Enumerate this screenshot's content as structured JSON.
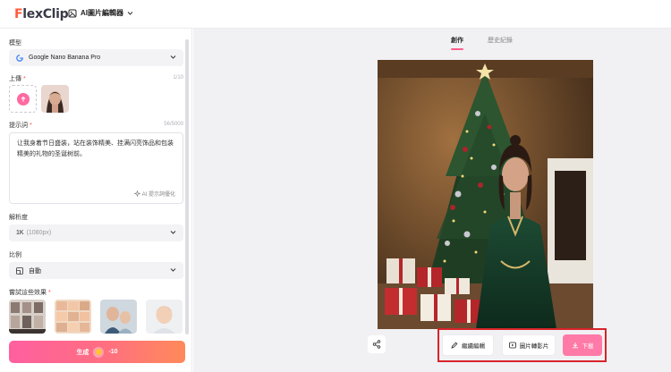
{
  "header": {
    "logo_prefix": "F",
    "logo_text": "lexClip",
    "tool_switch_label": "AI圖片編輯器"
  },
  "left_panel": {
    "model": {
      "label": "模型",
      "selected": "Google Nano Banana Pro"
    },
    "upload": {
      "label": "上傳",
      "required_mark": "*",
      "counter": "1/10"
    },
    "prompt": {
      "label": "提示詞",
      "required_mark": "*",
      "counter": "56/5000",
      "text": "让我身着节日盛装，站在装饰精美、挂满闪亮饰品和包装精美的礼物的圣诞树前。",
      "optimize_label": "AI 提示詞優化"
    },
    "resolution": {
      "label": "解析度",
      "selected": "1K",
      "selected_detail": "(1080px)"
    },
    "ratio": {
      "label": "比例",
      "selected": "自動"
    },
    "try_effects": {
      "label": "嘗試這些效果",
      "required_mark": "*"
    },
    "generate": {
      "label": "生成",
      "cost": "-10"
    }
  },
  "right_panel": {
    "tabs": [
      {
        "label": "創作"
      },
      {
        "label": "歷史紀錄"
      }
    ],
    "actions": {
      "edit_label": "繼續編輯",
      "image_to_video_label": "圖片轉影片",
      "download_label": "下載"
    }
  },
  "colors": {
    "accent_pink": "#ff5f8a",
    "highlight_red": "#d8232a",
    "logo_orange": "#ff5a3c"
  }
}
